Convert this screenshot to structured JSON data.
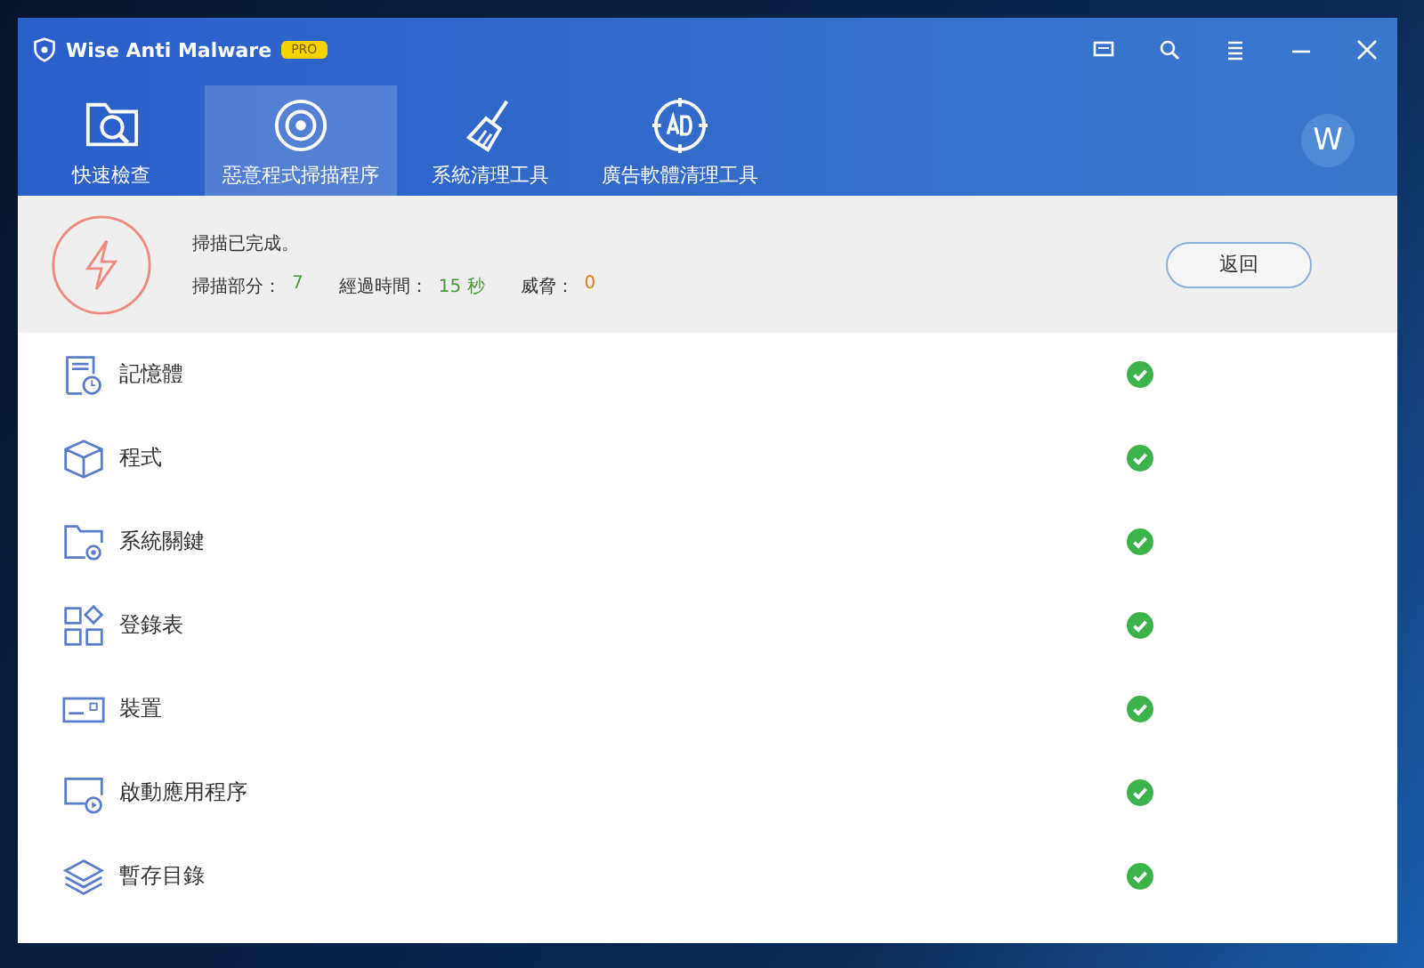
{
  "window": {
    "title": "Wise Anti Malware",
    "badge": "PRO",
    "avatar": "W"
  },
  "tabs": [
    {
      "label": "快速檢查",
      "selected": false
    },
    {
      "label": "惡意程式掃描程序",
      "selected": true
    },
    {
      "label": "系統清理工具",
      "selected": false
    },
    {
      "label": "廣告軟體清理工具",
      "selected": false
    }
  ],
  "summary": {
    "title": "掃描已完成。",
    "scanned_label": "掃描部分：",
    "scanned_value": "7",
    "time_label": "經過時間：",
    "time_value": "15 秒",
    "threat_label": "威脅：",
    "threat_value": "0",
    "button": "返回"
  },
  "items": [
    {
      "name": "記憶體",
      "passed": true
    },
    {
      "name": "程式",
      "passed": true
    },
    {
      "name": "系統關鍵",
      "passed": true
    },
    {
      "name": "登錄表",
      "passed": true
    },
    {
      "name": "裝置",
      "passed": true
    },
    {
      "name": "啟動應用程序",
      "passed": true
    },
    {
      "name": "暫存目錄",
      "passed": true
    }
  ]
}
